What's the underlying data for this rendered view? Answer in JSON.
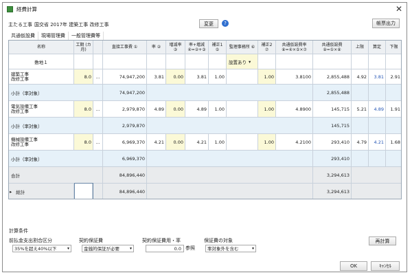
{
  "window": {
    "title": "経費計算",
    "close_glyph": "✕"
  },
  "main_work": {
    "label": "主たる工事",
    "value": "国交省 2017年 建築工事 改修工事",
    "change_label": "変更",
    "help_glyph": "?"
  },
  "print_label": "帳票出力",
  "tabs": [
    "共通仮設費",
    "現場管理費",
    "一般管理費等"
  ],
  "headers": {
    "name": "名称",
    "period": "工期\n(カ月)",
    "direct": "直接工事費\n①",
    "rate": "率\n②",
    "increase": "増减率\n③",
    "rate_inc": "率+増減\n④=②+③",
    "adj1": "補正1\n⑤",
    "office": "監理事務所\n⑥",
    "adj2": "補正2\n⑦",
    "common_rate": "共通仮設費率\n⑧=④×⑤×⑦",
    "common_cost": "共通仮設費\n⑨=①×⑧",
    "upper": "上限",
    "calc": "算定",
    "lower": "下限"
  },
  "site": {
    "name": "敷地１",
    "office_value": "設置あり",
    "dropdown_glyph": "▾"
  },
  "works": [
    {
      "name": "建築工事\n改修工事",
      "period": "8.0",
      "more": "…",
      "direct": "74,947,200",
      "rate": "3.81",
      "increase": "0.00",
      "rate_inc": "3.81",
      "adj1": "1.00",
      "adj2": "1.00",
      "common_rate": "3.8100",
      "common_cost": "2,855,488",
      "upper": "4.92",
      "calc": "3.81",
      "lower": "2.91",
      "subtotal_label": "小計（率対象）",
      "subtotal_direct": "74,947,200",
      "subtotal_cost": "2,855,488"
    },
    {
      "name": "電気設備工事\n改修工事",
      "period": "8.0",
      "more": "…",
      "direct": "2,979,870",
      "rate": "4.89",
      "increase": "0.00",
      "rate_inc": "4.89",
      "adj1": "1.00",
      "adj2": "1.00",
      "common_rate": "4.8900",
      "common_cost": "145,715",
      "upper": "5.21",
      "calc": "4.89",
      "lower": "1.91",
      "subtotal_label": "小計（率対象）",
      "subtotal_direct": "2,979,870",
      "subtotal_cost": "145,715"
    },
    {
      "name": "機械設備工事\n改修工事",
      "period": "8.0",
      "more": "…",
      "direct": "6,969,370",
      "rate": "4.21",
      "increase": "0.00",
      "rate_inc": "4.21",
      "adj1": "1.00",
      "adj2": "1.00",
      "common_rate": "4.2100",
      "common_cost": "293,410",
      "upper": "4.79",
      "calc": "4.21",
      "lower": "1.68",
      "subtotal_label": "小計（率対象）",
      "subtotal_direct": "6,969,370",
      "subtotal_cost": "293,410"
    }
  ],
  "total": {
    "label": "合計",
    "direct": "84,896,440",
    "cost": "3,294,613"
  },
  "grand_total": {
    "label": "総計",
    "direct": "84,896,440",
    "cost": "3,294,613",
    "row_marker": "▸"
  },
  "conditions": {
    "section_title": "計算条件",
    "advance": {
      "label": "前払金支出割合区分",
      "value": "35%を超え40%以下"
    },
    "contract": {
      "label": "契約保証費",
      "value": "金銭的保証が必要"
    },
    "rate": {
      "label": "契約保証費用・率",
      "value": "0.0",
      "ref_label": "参照"
    },
    "target": {
      "label": "保証費の対象",
      "value": "率対象外を含む"
    },
    "recalc_label": "再計算"
  },
  "footer": {
    "ok_label": "OK",
    "cancel_label": "ｷｬﾝｾﾙ"
  }
}
